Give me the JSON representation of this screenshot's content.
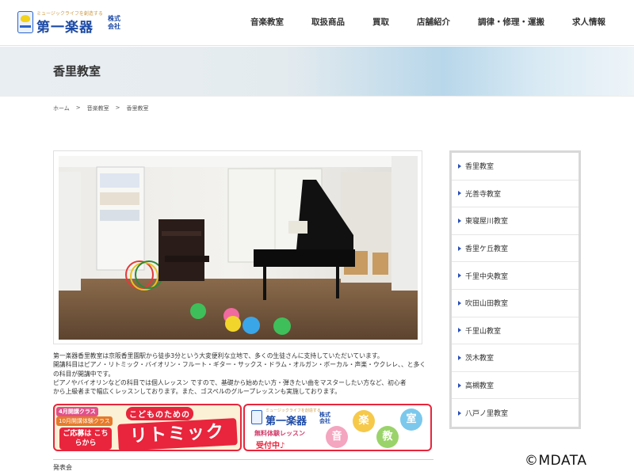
{
  "header": {
    "logo": {
      "tagline": "ミュージックライフを創造する",
      "name": "第一楽器",
      "corp": "株式会社"
    },
    "nav": [
      "音楽教室",
      "取扱商品",
      "買取",
      "店舗紹介",
      "調律・修理・運搬",
      "求人情報"
    ]
  },
  "banner": {
    "title": "香里教室"
  },
  "breadcrumb": [
    "ホーム",
    ">",
    "音楽教室",
    ">",
    "香里教室"
  ],
  "intro": {
    "lines": [
      "第一楽器香里教室は京阪香里園駅から徒歩3分という大変便利な立地で、多くの生徒さんに支持していただいています。",
      "開講科目はピアノ・リトミック・バイオリン・フルート・ギター・サックス・ドラム・オルガン・ボーカル・声楽・ウクレレ、、と多く",
      "の科目が開講中です。",
      "ピアノやバイオリンなどの科目では個人レッスン ですので、基礎から始めたい方・弾きたい曲をマスターしたい方など、初心者",
      "から上級者まで幅広くレッスンしております。また、ゴスペルのグループレッスンも実施しております。"
    ]
  },
  "promo_left": {
    "head": "4月開講クラス",
    "sub": "10月開講体験クラス",
    "cta": "ご応募は こちらから",
    "small": "こどものための",
    "big": "リトミック"
  },
  "promo_right": {
    "logo": {
      "tagline": "ミュージックライフを創造する",
      "name": "第一楽器",
      "corp": "株式会社"
    },
    "trial": "無料体験レッスン",
    "accept": "受付中♪",
    "bubbles": [
      "音",
      "楽",
      "教",
      "室"
    ]
  },
  "section": {
    "title": "発表会"
  },
  "sidebar": {
    "items": [
      "香里教室",
      "光善寺教室",
      "東寝屋川教室",
      "香里ケ丘教室",
      "千里中央教室",
      "吹田山田教室",
      "千里山教室",
      "茨木教室",
      "高槻教室",
      "八戸ノ里教室"
    ]
  },
  "watermark": "©MDATA",
  "colors": {
    "brand": "#1c4aa6",
    "accent": "#e8253c",
    "bullet": "#2a4fb8"
  }
}
